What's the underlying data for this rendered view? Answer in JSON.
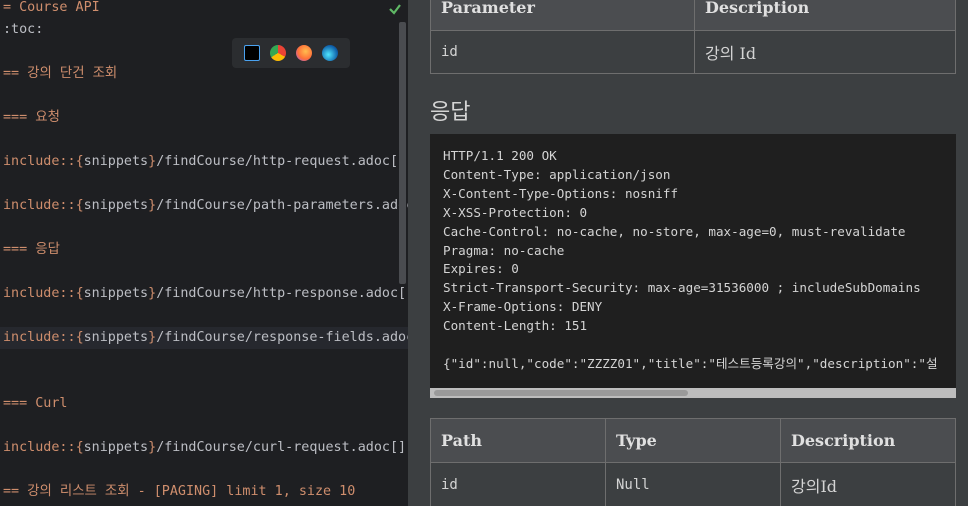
{
  "editor": {
    "lines": [
      {
        "text": "= Course API"
      },
      {
        "text": ":toc:"
      },
      {
        "text": "== 강의 단건 조회"
      },
      {
        "text": "=== 요청"
      },
      {
        "prefix": "include::",
        "brace_open": "{",
        "snip": "snippets",
        "brace_close": "}",
        "path": "/findCourse/http-request.adoc[]"
      },
      {
        "prefix": "include::",
        "brace_open": "{",
        "snip": "snippets",
        "brace_close": "}",
        "path": "/findCourse/path-parameters.adoc"
      },
      {
        "text": "=== 응답"
      },
      {
        "prefix": "include::",
        "brace_open": "{",
        "snip": "snippets",
        "brace_close": "}",
        "path": "/findCourse/http-response.adoc[]"
      },
      {
        "prefix": "include::",
        "brace_open": "{",
        "snip": "snippets",
        "brace_close": "}",
        "path": "/findCourse/response-fields.adoc"
      },
      {
        "text": "=== Curl"
      },
      {
        "prefix": "include::",
        "brace_open": "{",
        "snip": "snippets",
        "brace_close": "}",
        "path": "/findCourse/curl-request.adoc[]"
      },
      {
        "text": "== 강의 리스트 조회 - [PAGING] limit 1, size 10"
      }
    ],
    "check_icon": "check-icon",
    "browser_icons": [
      "intellij-icon",
      "chrome-icon",
      "firefox-icon",
      "edge-icon"
    ]
  },
  "preview": {
    "params_table": {
      "headers": [
        "Parameter",
        "Description"
      ],
      "row": [
        "id",
        "강의 Id"
      ]
    },
    "response_heading": "응답",
    "http_response": "HTTP/1.1 200 OK\nContent-Type: application/json\nX-Content-Type-Options: nosniff\nX-XSS-Protection: 0\nCache-Control: no-cache, no-store, max-age=0, must-revalidate\nPragma: no-cache\nExpires: 0\nStrict-Transport-Security: max-age=31536000 ; includeSubDomains\nX-Frame-Options: DENY\nContent-Length: 151\n\n{\"id\":null,\"code\":\"ZZZZ01\",\"title\":\"테스트등록강의\",\"description\":\"설",
    "fields_table": {
      "headers": [
        "Path",
        "Type",
        "Description"
      ],
      "row": [
        "id",
        "Null",
        "강의Id"
      ]
    }
  },
  "colors": {
    "editor_bg": "#1e1f22",
    "heading_orange": "#cf8e6d",
    "preview_bg": "#3c3f41",
    "check_green": "#5fb865"
  }
}
